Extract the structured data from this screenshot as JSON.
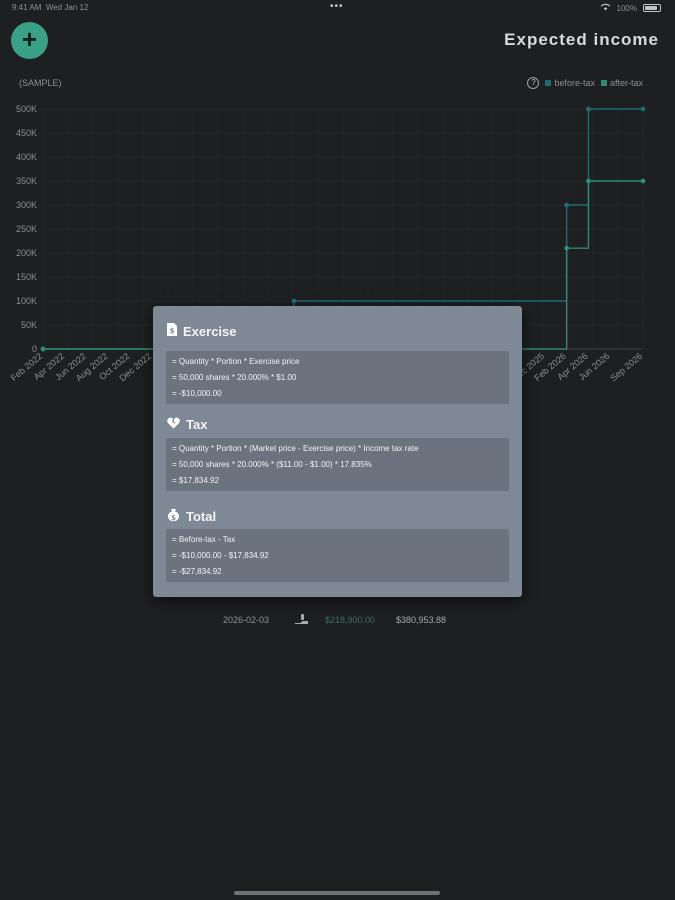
{
  "status_bar": {
    "time": "9:41 AM",
    "date": "Wed Jan 12",
    "menu_dots": "•••",
    "battery": "100%"
  },
  "header": {
    "add_symbol": "+",
    "title": "Expected income"
  },
  "sample_label": "(SAMPLE)",
  "legend": {
    "help": "?",
    "before_label": "before-tax",
    "after_label": "after-tax",
    "before_color": "#1f6b74",
    "after_color": "#2d8c73"
  },
  "chart_data": {
    "type": "line",
    "step": true,
    "y_ticks": [
      "0",
      "50K",
      "100K",
      "150K",
      "200K",
      "250K",
      "300K",
      "350K",
      "400K",
      "450K",
      "500K"
    ],
    "ylim": [
      0,
      500000
    ],
    "x_labels_left": [
      "Feb 2022",
      "Apr 2022",
      "Jun 2022",
      "Aug 2022",
      "Oct 2022",
      "Dec 2022"
    ],
    "x_labels_right": [
      "Dec 2025",
      "Feb 2026",
      "Apr 2026",
      "Jun 2026",
      "Sep 2026"
    ],
    "series": [
      {
        "name": "before-tax",
        "color": "#1f6b74",
        "points": [
          [
            "Feb 2022",
            0
          ],
          [
            "Jan 2024",
            100000
          ],
          [
            "Feb 2026",
            300000
          ],
          [
            "Apr 2026",
            500000
          ],
          [
            "Sep 2026",
            500000
          ]
        ]
      },
      {
        "name": "after-tax",
        "color": "#2d8c73",
        "points": [
          [
            "Feb 2022",
            0
          ],
          [
            "Feb 2026",
            210000
          ],
          [
            "Apr 2026",
            350000
          ],
          [
            "Sep 2026",
            350000
          ]
        ]
      }
    ]
  },
  "row": {
    "date": "2026-02-03",
    "icon": "hand-money",
    "before": "$218,900.00",
    "after": "$380,953.88"
  },
  "popup": {
    "exercise": {
      "title": "Exercise",
      "icon": "document-dollar",
      "lines": [
        "= Quantity * Portion * Exercise price",
        "= 50,000 shares * 20.000% * $1.00",
        "= -$10,000.00"
      ]
    },
    "tax": {
      "title": "Tax",
      "icon": "broken-heart",
      "lines": [
        "= Quantity * Portion * (Market price - Exercise price) * Income tax rate",
        "= 50,000 shares * 20.000% * ($11.00 - $1.00) * 17.835%",
        "= $17,834.92"
      ]
    },
    "total": {
      "title": "Total",
      "icon": "money-bag",
      "lines": [
        "= Before-tax - Tax",
        "= -$10,000.00 - $17,834.92",
        "= -$27,834.92"
      ]
    }
  }
}
